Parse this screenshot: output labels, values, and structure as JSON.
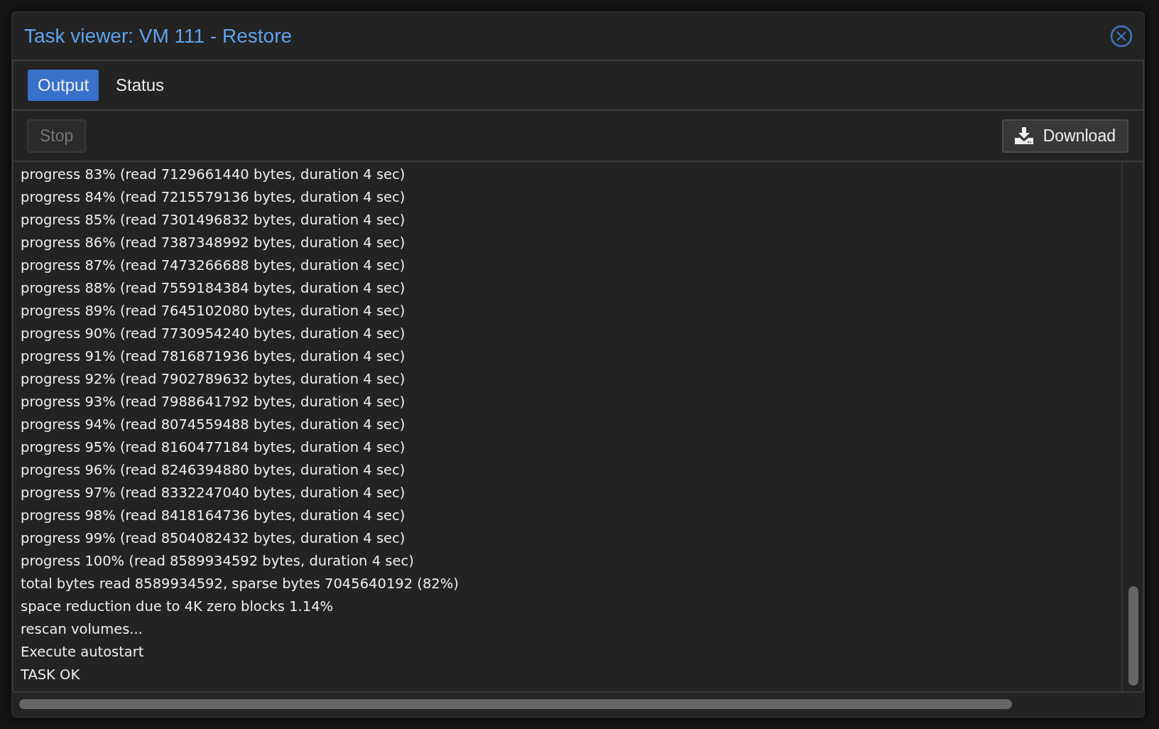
{
  "window": {
    "title": "Task viewer: VM 111 - Restore"
  },
  "tabs": [
    {
      "label": "Output",
      "selected": true
    },
    {
      "label": "Status",
      "selected": false
    }
  ],
  "toolbar": {
    "stop": {
      "label": "Stop",
      "disabled": true
    },
    "download": {
      "label": "Download",
      "disabled": false
    }
  },
  "log_lines": [
    "progress 83% (read 7129661440 bytes, duration 4 sec)",
    "progress 84% (read 7215579136 bytes, duration 4 sec)",
    "progress 85% (read 7301496832 bytes, duration 4 sec)",
    "progress 86% (read 7387348992 bytes, duration 4 sec)",
    "progress 87% (read 7473266688 bytes, duration 4 sec)",
    "progress 88% (read 7559184384 bytes, duration 4 sec)",
    "progress 89% (read 7645102080 bytes, duration 4 sec)",
    "progress 90% (read 7730954240 bytes, duration 4 sec)",
    "progress 91% (read 7816871936 bytes, duration 4 sec)",
    "progress 92% (read 7902789632 bytes, duration 4 sec)",
    "progress 93% (read 7988641792 bytes, duration 4 sec)",
    "progress 94% (read 8074559488 bytes, duration 4 sec)",
    "progress 95% (read 8160477184 bytes, duration 4 sec)",
    "progress 96% (read 8246394880 bytes, duration 4 sec)",
    "progress 97% (read 8332247040 bytes, duration 4 sec)",
    "progress 98% (read 8418164736 bytes, duration 4 sec)",
    "progress 99% (read 8504082432 bytes, duration 4 sec)",
    "progress 100% (read 8589934592 bytes, duration 4 sec)",
    "total bytes read 8589934592, sparse bytes 7045640192 (82%)",
    "space reduction due to 4K zero blocks 1.14%",
    "rescan volumes...",
    "Execute autostart",
    "TASK OK"
  ]
}
